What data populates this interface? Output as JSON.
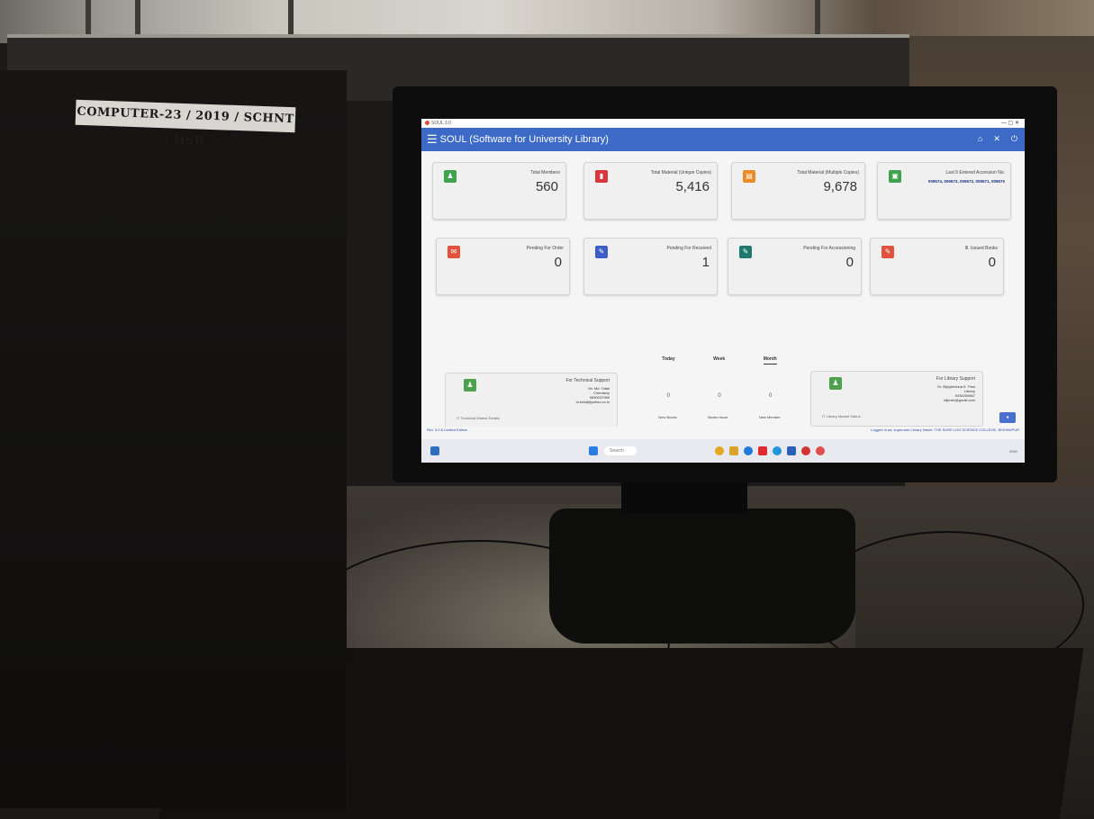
{
  "sticker": {
    "text": "COMPUTER-23 / 2019 / SCHNT / HSR"
  },
  "app": {
    "window_title": "SOUL 3.0",
    "title": "SOUL (Software for University Library)",
    "header_icons": [
      "home-icon",
      "tools-icon",
      "power-icon"
    ]
  },
  "cards": [
    {
      "label": "Total Members",
      "value": "560",
      "color": "#3fa34d"
    },
    {
      "label": "Total Material (Unique Copies)",
      "value": "5,416",
      "color": "#d9363e"
    },
    {
      "label": "Total Material (Multiple Copies)",
      "value": "9,678",
      "color": "#e98b2a"
    },
    {
      "label": "Last 5 Entered Accession No.",
      "value": "009574, 009573, 009572, 009571, 009570",
      "color": "#3fa34d"
    },
    {
      "label": "Pending For Order",
      "value": "0",
      "color": "#e0523a"
    },
    {
      "label": "Pending For Received",
      "value": "1",
      "color": "#3d5cc7"
    },
    {
      "label": "Pending For Accessioning",
      "value": "0",
      "color": "#1f7a6e"
    },
    {
      "label": "Ill. Issued Books",
      "value": "0",
      "color": "#e0523a"
    }
  ],
  "support_tech": {
    "title": "For Technical Support",
    "lines": [
      "Mr. Md. Tofail",
      "Chemistry",
      "9830037989",
      "m.tofail@yahoo.co.in"
    ],
    "link": "IT Technical Market Details"
  },
  "support_library": {
    "title": "For Library Support",
    "lines": [
      "Dr. Bijoykrishna K. Paul",
      "Library",
      "9434259867",
      "bijkrisb@gmail.com"
    ],
    "link": "IT Library Market Status"
  },
  "stats": {
    "tabs": [
      "Today",
      "Week",
      "Month"
    ],
    "active_tab": "Month",
    "values": [
      "0",
      "0",
      "0"
    ],
    "labels": [
      "New Books",
      "Books Issue",
      "New Member"
    ]
  },
  "status": {
    "left": "Rev. 3.0.6 Limited Edition",
    "right": "Logged In as: superuser     Library Name: THE SURE LOG SCIENCE COLLEGE, BISHNUPUR"
  },
  "taskbar": {
    "search_placeholder": "Search",
    "tray_text": "ENG"
  }
}
